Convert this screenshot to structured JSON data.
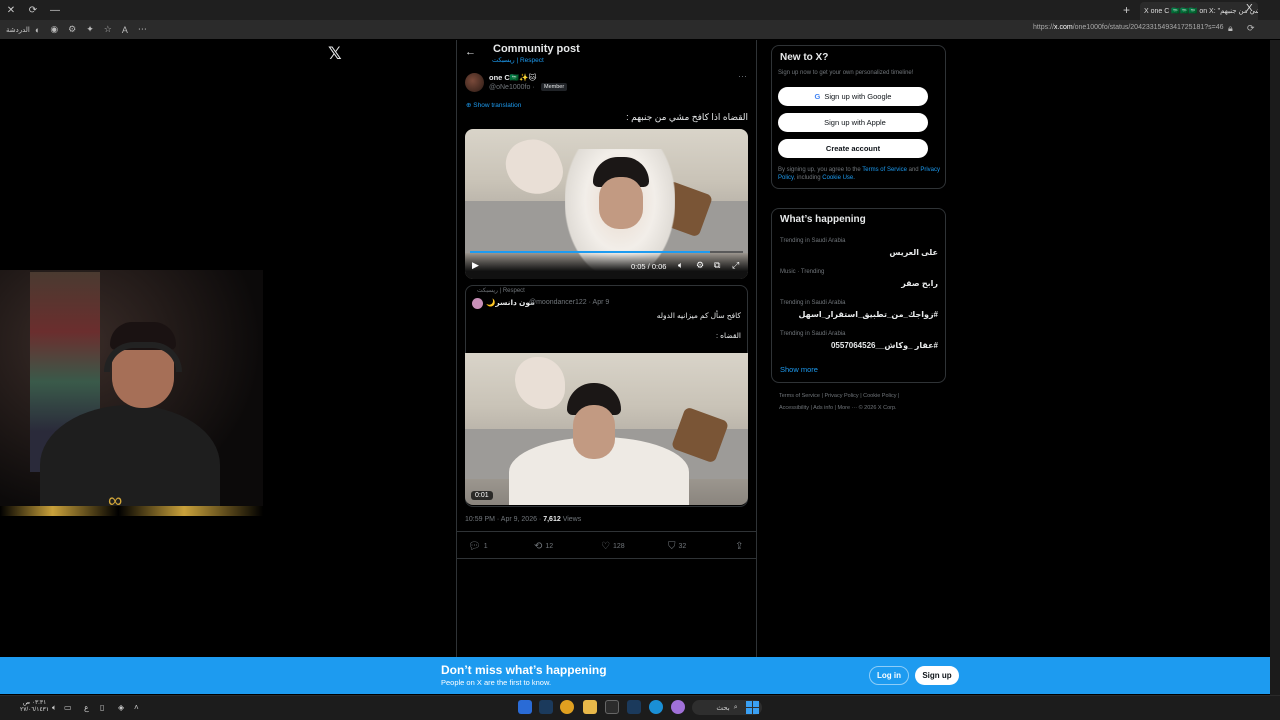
{
  "browser": {
    "tab_title": "X one C 🇸🇦🇸🇦🇸🇦 on X: \"القضاه اذا كافح مشي من جنبهم",
    "url_prefix": "https://",
    "url_domain": "x.com",
    "url_path": "/one1000fo/status/2042331549341725181?s=46",
    "left_label": "الدردشة",
    "new_tab": "+",
    "close": "✕",
    "reload": "⟳",
    "minimize": "—",
    "x_corner": "X"
  },
  "nav": {
    "logo": "𝕏"
  },
  "post": {
    "back": "←",
    "header_title": "Community post",
    "community": "ريسبكت | Respect",
    "username": "one C🇸🇦✨🐱",
    "handle": "@oNe1000fo ·",
    "badge": "Member",
    "more": "···",
    "translate": "Show translation",
    "text": "القضاه اذا كافح مشي من جنبهم :",
    "video_time": "0:05 / 0:06",
    "timestamp": "10:59 PM · Apr 9, 2026 · ",
    "views_count": "7,612",
    "views_label": " Views",
    "progress": 0.88
  },
  "quote": {
    "community": "ريسبكت | Respect",
    "name": "🌙مون دانسر",
    "handle": "@moondancer122 · Apr 9",
    "line1": "كافح سأل كم ميزانيه الدوله",
    "line2": "القضاه :",
    "duration": "0:01"
  },
  "actions": {
    "replies": "1",
    "reposts": "12",
    "likes": "128",
    "bookmarks": "32"
  },
  "sidebar": {
    "newx_title": "New to X?",
    "newx_sub": "Sign up now to get your own personalized timeline!",
    "google": "Sign up with Google",
    "apple": "Sign up with Apple",
    "create": "Create account",
    "legal_a": "By signing up, you agree to the ",
    "legal_terms": "Terms of Service",
    "legal_b": " and ",
    "legal_privacy": "Privacy Policy",
    "legal_c": ", including ",
    "legal_cookie": "Cookie Use.",
    "happening_title": "What’s happening",
    "trends": [
      {
        "context": "Trending in Saudi Arabia",
        "name": "على العريس"
      },
      {
        "context": "Music · Trending",
        "name": "رابح صقر"
      },
      {
        "context": "Trending in Saudi Arabia",
        "name": "#زواجك_من_تطبيق_استقرار_اسهل"
      },
      {
        "context": "Trending in Saudi Arabia",
        "name": "#عقار _وكاش__0557064526"
      }
    ],
    "show_more": "Show more",
    "footer1": "Terms of Service  |  Privacy Policy  |  Cookie Policy  |",
    "footer2": "Accessibility  |  Ads info  |  More ···  © 2026 X Corp."
  },
  "banner": {
    "title": "Don’t miss what’s happening",
    "subtitle": "People on X are the first to know.",
    "login": "Log in",
    "signup": "Sign up"
  },
  "taskbar": {
    "time": "٠٣:٣١ ص",
    "date": "٢٧/٠٦/١٤٣١",
    "search": "بحث",
    "lang": "ع"
  },
  "colors": {
    "accent": "#1d9bf0",
    "bg": "#000000",
    "border": "#2f3336"
  }
}
